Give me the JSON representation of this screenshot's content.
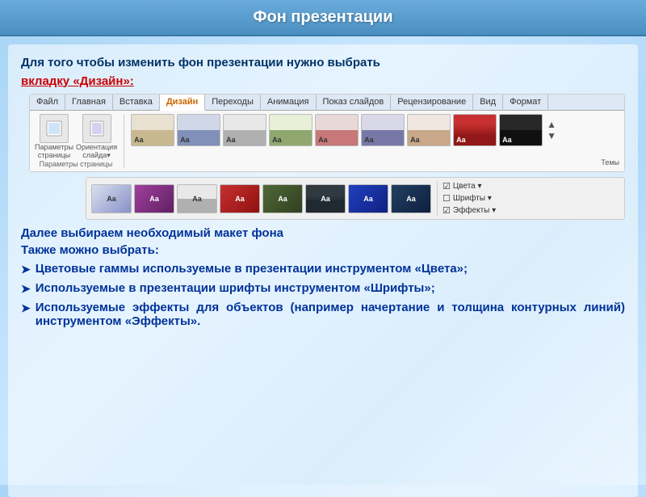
{
  "title": "Фон презентации",
  "intro": {
    "text": "Для того чтобы изменить фон презентации нужно выбрать вкладку «Дизайн»:",
    "highlight": "вкладку «Дизайн»:"
  },
  "ribbon": {
    "tabs": [
      "Файл",
      "Главная",
      "Вставка",
      "Дизайн",
      "Переходы",
      "Анимация",
      "Показ слайдов",
      "Рецензирование",
      "Вид",
      "Формат"
    ],
    "active_tab": "Дизайн",
    "group_label": "Параметры страницы",
    "icon1_label": "Параметры страницы",
    "icon2_label": "Ориентация слайда",
    "themes_label": "Темы"
  },
  "body": {
    "step1": "Далее выбираем необходимый макет фона",
    "step2_label": "Также можно выбрать:",
    "bullets": [
      "Цветовые  гаммы  используемые  в  презентации инструментом «Цвета»;",
      "Используемые  в  презентации  шрифты  инструментом «Шрифты»;",
      "Используемые  эффекты  для  объектов  (например начертание  и  толщина  контурных  линий)  инструментом «Эффекты»."
    ],
    "menu_items": [
      "Цвета ▾",
      "Шрифты ▾",
      "Эффекты ▾"
    ]
  }
}
